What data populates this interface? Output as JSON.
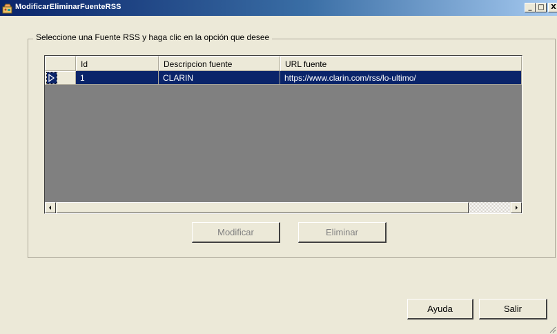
{
  "window": {
    "title": "ModificarEliminarFuenteRSS",
    "icon": "rss-app-icon",
    "controls": {
      "minimize": "_",
      "maximize": "□",
      "close": "X"
    }
  },
  "group": {
    "legend": "Seleccione una Fuente RSS y haga clic en la opción que desee"
  },
  "grid": {
    "columns": [
      "Id",
      "Descripcion fuente",
      "URL fuente"
    ],
    "rows": [
      {
        "id": "1",
        "descripcion": "CLARIN",
        "url": "https://www.clarin.com/rss/lo-ultimo/",
        "selected": true
      }
    ],
    "selection_color": "#0a246a",
    "empty_area_color": "#808080"
  },
  "actions": {
    "modificar": "Modificar",
    "eliminar": "Eliminar",
    "ayuda": "Ayuda",
    "salir": "Salir"
  }
}
